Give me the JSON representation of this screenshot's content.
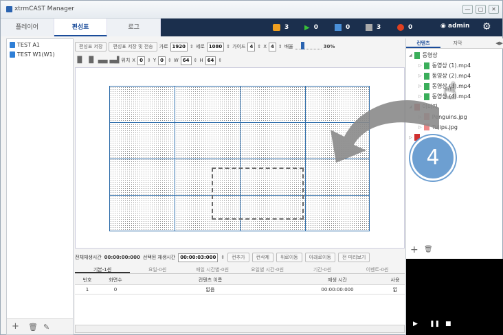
{
  "window": {
    "title": "xtrmCAST Manager",
    "controls": [
      "—",
      "▢",
      "✕"
    ]
  },
  "tabs": [
    {
      "label": "플레이어"
    },
    {
      "label": "편성표"
    },
    {
      "label": "로그"
    }
  ],
  "status": [
    {
      "icon": "alert-icon",
      "value": "3",
      "color": "#f0a020"
    },
    {
      "icon": "play-icon",
      "value": "0",
      "color": "#38c038"
    },
    {
      "icon": "stop-icon",
      "value": "0",
      "color": "#4a90d9"
    },
    {
      "icon": "pause-icon",
      "value": "3",
      "color": "#aaaaaa"
    },
    {
      "icon": "error-icon",
      "value": "0",
      "color": "#e04020"
    }
  ],
  "user": {
    "name": "admin"
  },
  "schedules": [
    {
      "label": "TEST A1"
    },
    {
      "label": "TEST W1(W1)"
    }
  ],
  "toolbar": {
    "save": "편성표 저장",
    "save_send": "편성표 저장 및 전송",
    "width_label": "가로",
    "width": "1920",
    "height_label": "세로",
    "height": "1080",
    "guide_label": "가이드",
    "guide_x": "4",
    "guide_sep": "X",
    "guide_y": "4",
    "zoom_label": "배율",
    "zoom": "30%",
    "pos_label": "위치",
    "x_label": "X",
    "x": "0",
    "y_label": "Y",
    "y": "0",
    "w_label": "W",
    "w": "64",
    "h_label": "H",
    "h": "64"
  },
  "info": {
    "total_label": "전체재생시간",
    "total": "00:00:00:000",
    "selected_label": "선택된 재생시간",
    "selected": "00:00:03:000",
    "buttons": [
      "컨추가",
      "컨삭제",
      "위로이동",
      "아래로이동",
      "전 미리보기"
    ]
  },
  "subtabs": [
    {
      "label": "기본-1씬"
    },
    {
      "label": "요일-0씬"
    },
    {
      "label": "매일 시간별-0씬"
    },
    {
      "label": "요일별 시간-0씬"
    },
    {
      "label": "기간-0씬"
    },
    {
      "label": "이벤트-0씬"
    }
  ],
  "table": {
    "headers": [
      "번호",
      "화면수",
      "컨텐츠 이름",
      "재생 시간",
      "사용"
    ],
    "rows": [
      [
        "1",
        "0",
        "없음",
        "00:00:00:000",
        "없"
      ]
    ]
  },
  "right": {
    "tabs": [
      "컨텐츠",
      "자막"
    ],
    "tree": [
      {
        "label": "동영상",
        "level": 0
      },
      {
        "label": "동영상 (1).mp4",
        "level": 1
      },
      {
        "label": "동영상 (2).mp4",
        "level": 1
      },
      {
        "label": "동영상 (3).mp4",
        "level": 1
      },
      {
        "label": "동영상 (4).mp4",
        "level": 1
      },
      {
        "label": "이미지",
        "level": 0
      },
      {
        "label": "Penguins.jpg",
        "level": 1
      },
      {
        "label": "Tulips.jpg",
        "level": 1
      }
    ]
  },
  "callout": {
    "step": "4"
  }
}
